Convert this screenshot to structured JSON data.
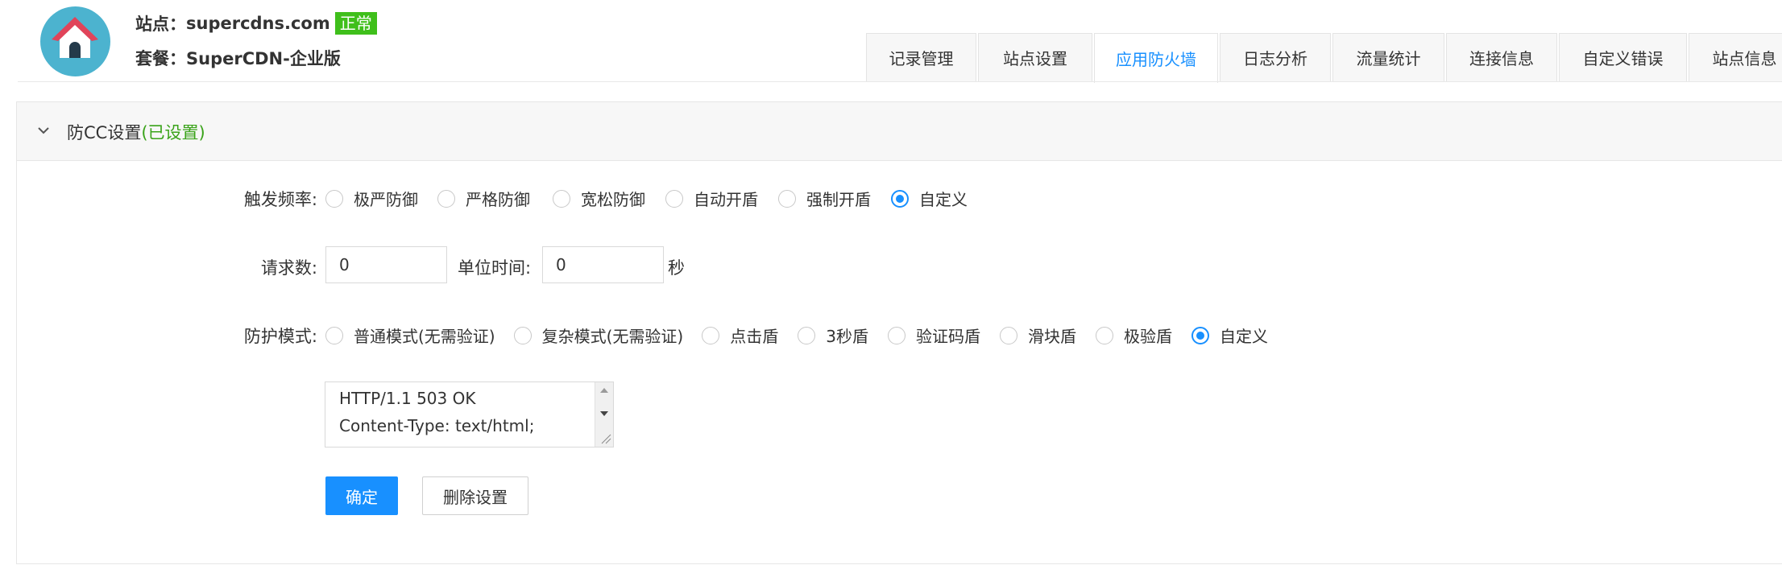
{
  "header": {
    "site_label": "站点：",
    "site_domain": "supercdns.com",
    "site_status": "正常",
    "plan_label": "套餐：",
    "plan_name": "SuperCDN-企业版"
  },
  "tabs": [
    {
      "label": "记录管理"
    },
    {
      "label": "站点设置"
    },
    {
      "label": "应用防火墙",
      "active": true
    },
    {
      "label": "日志分析"
    },
    {
      "label": "流量统计"
    },
    {
      "label": "连接信息"
    },
    {
      "label": "自定义错误"
    },
    {
      "label": "站点信息"
    }
  ],
  "panel": {
    "title": "防CC设置",
    "title_status": "(已设置)"
  },
  "form": {
    "trigger_label": "触发频率:",
    "trigger_options": [
      "极严防御",
      "严格防御",
      "宽松防御",
      "自动开盾",
      "强制开盾",
      "自定义"
    ],
    "trigger_selected": "自定义",
    "requests_label": "请求数:",
    "requests_value": "0",
    "unit_time_label": "单位时间:",
    "unit_time_value": "0",
    "unit_suffix": "秒",
    "mode_label": "防护模式:",
    "mode_options": [
      "普通模式(无需验证)",
      "复杂模式(无需验证)",
      "点击盾",
      "3秒盾",
      "验证码盾",
      "滑块盾",
      "极验盾",
      "自定义"
    ],
    "mode_selected": "自定义",
    "custom_response_lines": [
      "HTTP/1.1 503 OK",
      "Content-Type: text/html;"
    ],
    "confirm_label": "确定",
    "delete_label": "删除设置"
  },
  "colors": {
    "accent": "#1890ff",
    "status_badge": "#3fbf1b",
    "set_status_text": "#3aa31a",
    "avatar_bg": "#4cb3cf",
    "house_roof": "#e0445a"
  }
}
